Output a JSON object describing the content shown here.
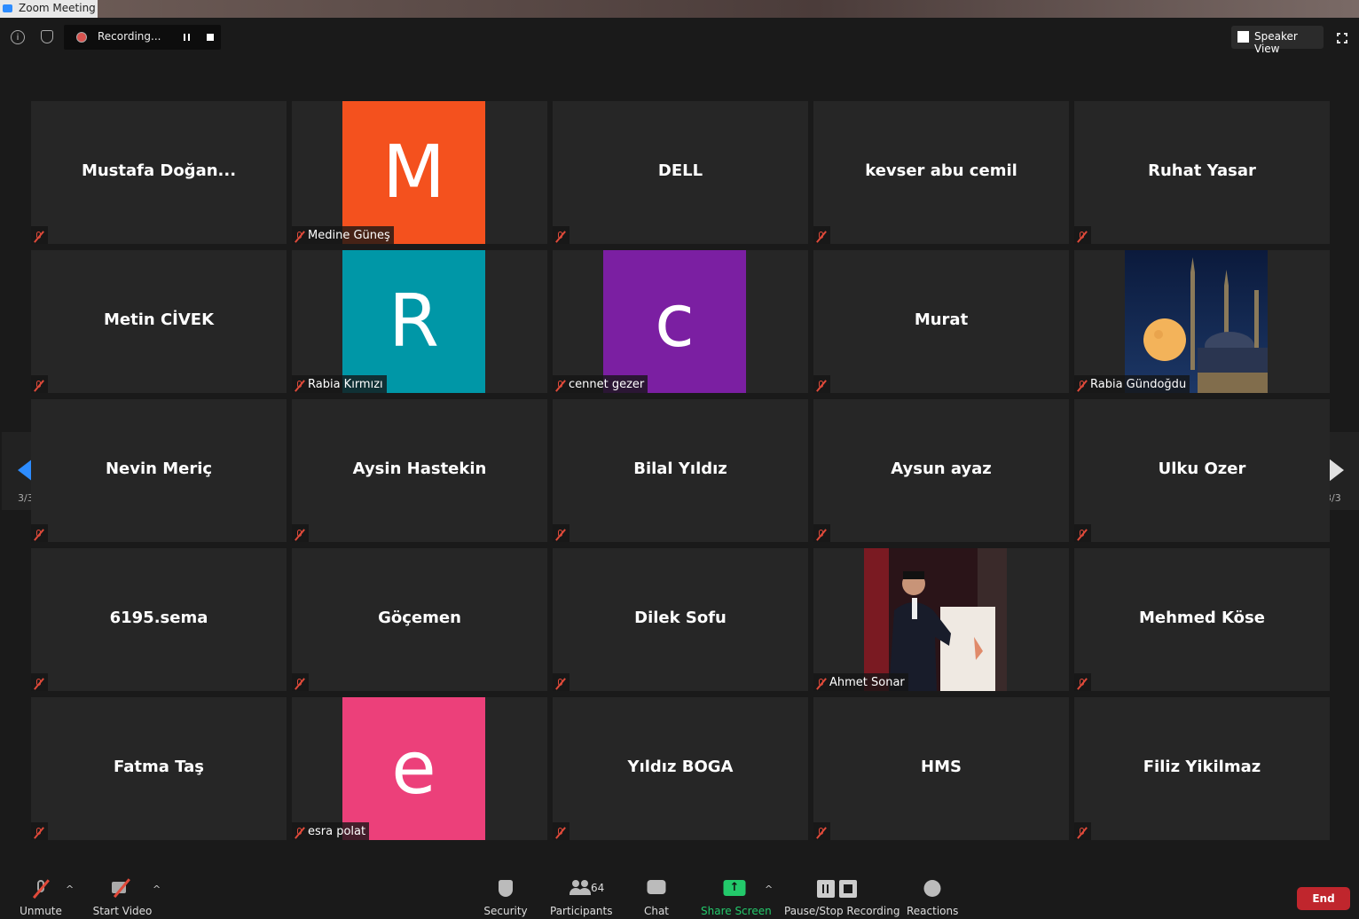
{
  "window": {
    "title": "Zoom Meeting"
  },
  "topbar": {
    "recording_label": "Recording...",
    "view_label": "Speaker View"
  },
  "colors": {
    "accent": "#2d8cff",
    "end": "#c0262d",
    "share": "#23c96b"
  },
  "pagination": {
    "current_label": "3/3"
  },
  "participants": [
    {
      "name": "Mustafa  Doğan...",
      "type": "name"
    },
    {
      "name": "Medine Güneş",
      "type": "avatar",
      "letter": "M",
      "color": "#f4511e"
    },
    {
      "name": "DELL",
      "type": "name"
    },
    {
      "name": "kevser abu cemil",
      "type": "name"
    },
    {
      "name": "Ruhat Yasar",
      "type": "name"
    },
    {
      "name": "Metin CİVEK",
      "type": "name"
    },
    {
      "name": "Rabia Kırmızı",
      "type": "avatar",
      "letter": "R",
      "color": "#0097a7"
    },
    {
      "name": "cennet gezer",
      "type": "avatar",
      "letter": "c",
      "color": "#7b1fa2"
    },
    {
      "name": "Murat",
      "type": "name"
    },
    {
      "name": "Rabia Gündoğdu",
      "type": "photo",
      "photo": "mosque"
    },
    {
      "name": "Nevin Meriç",
      "type": "name"
    },
    {
      "name": "Aysin Hastekin",
      "type": "name"
    },
    {
      "name": "Bilal Yıldız",
      "type": "name"
    },
    {
      "name": "Aysun ayaz",
      "type": "name"
    },
    {
      "name": "Ulku Ozer",
      "type": "name"
    },
    {
      "name": "6195.sema",
      "type": "name"
    },
    {
      "name": "Göçemen",
      "type": "name"
    },
    {
      "name": "Dilek Sofu",
      "type": "name"
    },
    {
      "name": "Ahmet Sonar",
      "type": "photo",
      "photo": "speaker"
    },
    {
      "name": "Mehmed Köse",
      "type": "name"
    },
    {
      "name": "Fatma Taş",
      "type": "name"
    },
    {
      "name": "esra polat",
      "type": "avatar",
      "letter": "e",
      "color": "#ec407a"
    },
    {
      "name": "Yıldız BOGA",
      "type": "name"
    },
    {
      "name": "HMS",
      "type": "name"
    },
    {
      "name": "Filiz Yikilmaz",
      "type": "name"
    }
  ],
  "toolbar": {
    "unmute": "Unmute",
    "start_video": "Start Video",
    "security": "Security",
    "participants": "Participants",
    "participants_count": "64",
    "chat": "Chat",
    "share_screen": "Share Screen",
    "pause_stop": "Pause/Stop Recording",
    "reactions": "Reactions",
    "end": "End"
  },
  "icons": [
    "info-icon",
    "shield-icon",
    "record-icon",
    "pause-icon",
    "stop-icon",
    "grid-icon",
    "fullscreen-icon",
    "muted-mic-icon",
    "video-off-icon",
    "security-shield-icon",
    "participants-icon",
    "chat-icon",
    "share-screen-icon",
    "reactions-icon"
  ]
}
